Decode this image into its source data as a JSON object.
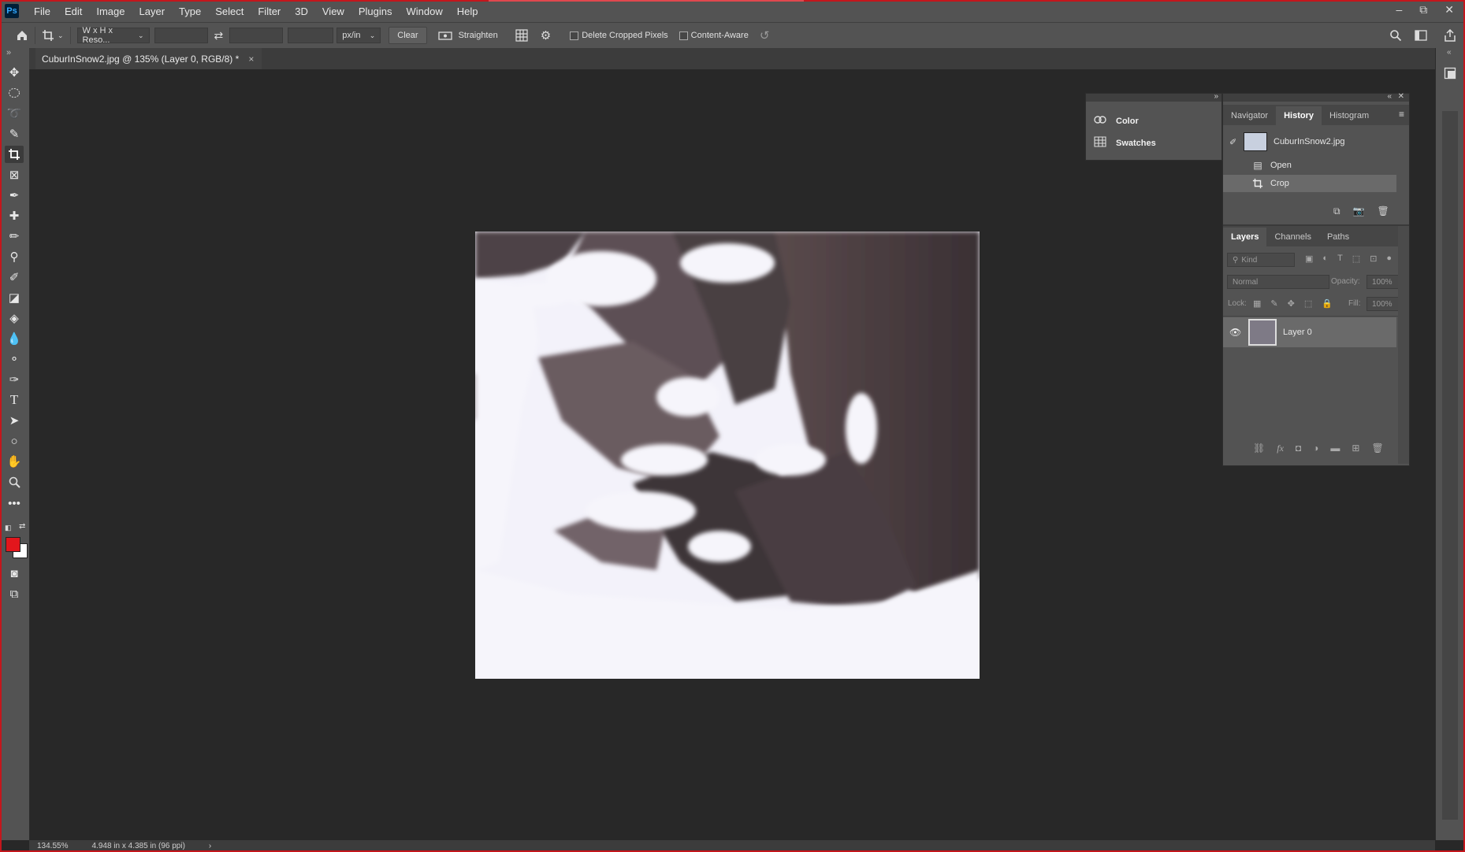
{
  "app": {
    "logo": "Ps"
  },
  "menubar": {
    "items": [
      "File",
      "Edit",
      "Image",
      "Layer",
      "Type",
      "Select",
      "Filter",
      "3D",
      "View",
      "Plugins",
      "Window",
      "Help"
    ]
  },
  "window_controls": {
    "minimize": "–",
    "restore": "⧉",
    "close": "✕"
  },
  "options_bar": {
    "ratio_preset": "W x H x Reso...",
    "units": "px/in",
    "clear_label": "Clear",
    "straighten_label": "Straighten",
    "delete_cropped_label": "Delete Cropped Pixels",
    "content_aware_label": "Content-Aware"
  },
  "document_tab": {
    "title": "CuburInSnow2.jpg @ 135% (Layer 0, RGB/8) *",
    "close": "×"
  },
  "collapsed_panels": {
    "color_label": "Color",
    "swatches_label": "Swatches"
  },
  "history_panel": {
    "tabs": [
      "Navigator",
      "History",
      "Histogram"
    ],
    "active_tab": "History",
    "snapshot": "CuburInSnow2.jpg",
    "states": [
      "Open",
      "Crop"
    ],
    "selected_state": "Crop"
  },
  "layers_panel": {
    "tabs": [
      "Layers",
      "Channels",
      "Paths"
    ],
    "active_tab": "Layers",
    "kind_placeholder": "Kind",
    "blend_mode": "Normal",
    "opacity_label": "Opacity:",
    "opacity_value": "100%",
    "lock_label": "Lock:",
    "fill_label": "Fill:",
    "fill_value": "100%",
    "layers": [
      {
        "name": "Layer 0",
        "visible": true
      }
    ]
  },
  "status_bar": {
    "zoom": "134.55%",
    "doc_size": "4.948 in x 4.385 in (96 ppi)",
    "arrow": "›"
  },
  "colors": {
    "foreground": "#e3161c",
    "background": "#ffffff",
    "frame": "#c4161c"
  }
}
